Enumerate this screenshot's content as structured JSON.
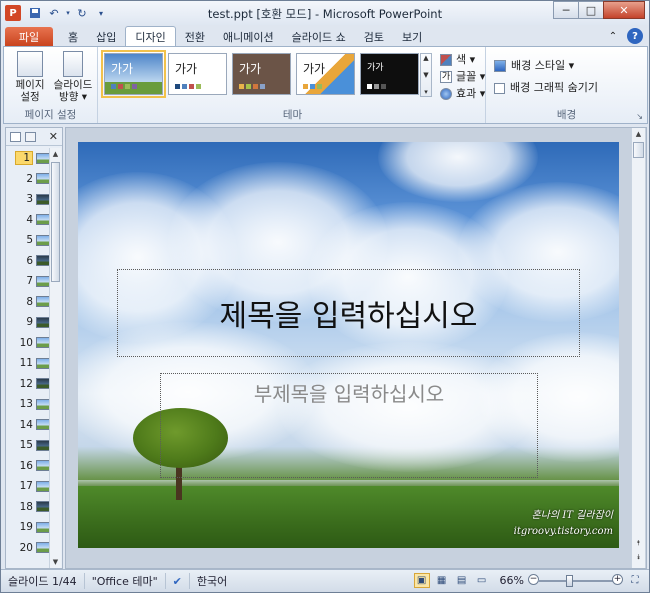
{
  "window": {
    "title": "test.ppt [호환 모드] - Microsoft PowerPoint",
    "app_icon": "P",
    "qat": [
      "save-icon",
      "undo-icon",
      "redo-icon",
      "customize-icon"
    ],
    "controls": {
      "minimize": "─",
      "maximize": "□",
      "close": "✕"
    }
  },
  "tabs": {
    "file": "파일",
    "items": [
      "홈",
      "삽입",
      "디자인",
      "전환",
      "애니메이션",
      "슬라이드 쇼",
      "검토",
      "보기"
    ],
    "active": "디자인"
  },
  "ribbon": {
    "page_setup": {
      "label": "페이지 설정",
      "buttons": [
        {
          "label": "페이지\n설정"
        },
        {
          "label": "슬라이드\n방향 ▾"
        }
      ]
    },
    "theme": {
      "label": "테마",
      "thumbnail_text": "가가",
      "options": {
        "colors": "색 ▾",
        "fonts": "글꼴 ▾",
        "effects": "효과 ▾"
      }
    },
    "background": {
      "label": "배경",
      "styles": "배경 스타일 ▾",
      "hide_graphics": "배경 그래픽 숨기기"
    }
  },
  "slides_pane": {
    "numbers": [
      "1",
      "2",
      "3",
      "4",
      "5",
      "6",
      "7",
      "8",
      "9",
      "10",
      "11",
      "12",
      "13",
      "14",
      "15",
      "16",
      "17",
      "18",
      "19",
      "20"
    ],
    "selected": 1
  },
  "slide": {
    "title_placeholder": "제목을 입력하십시오",
    "subtitle_placeholder": "부제목을 입력하십시오",
    "watermark_line1": "혼나의 IT 길라잡이",
    "watermark_line2": "itgroovy.tistory.com"
  },
  "statusbar": {
    "slide_count": "슬라이드 1/44",
    "theme": "\"Office 테마\"",
    "language": "한국어",
    "zoom": "66%",
    "zoom_fraction": 0.66
  },
  "colors": {
    "file_tab": "#c7411c",
    "selection": "#f2c24b",
    "accent": "#2f66c0"
  }
}
